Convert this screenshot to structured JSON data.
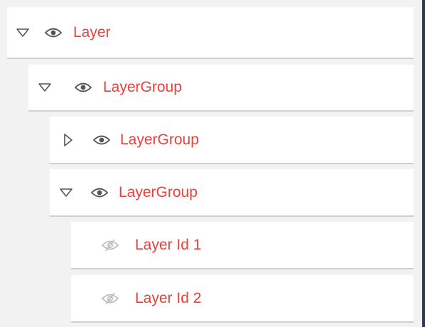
{
  "colors": {
    "label": "#e8403a",
    "icon": "#555555",
    "icon_muted": "#bbbbbb",
    "row_bg": "#ffffff",
    "page_bg": "#f2f2f2"
  },
  "tree": {
    "root": {
      "label": "Layer",
      "state": "expanded",
      "visible": true
    },
    "group1": {
      "label": "LayerGroup",
      "state": "expanded",
      "visible": true
    },
    "group2": {
      "label": "LayerGroup",
      "state": "collapsed",
      "visible": true
    },
    "group3": {
      "label": "LayerGroup",
      "state": "expanded",
      "visible": true
    },
    "layer1": {
      "label": "Layer Id 1",
      "visible": false
    },
    "layer2": {
      "label": "Layer Id 2",
      "visible": false
    }
  },
  "icons": {
    "expanded": "triangle-down-icon",
    "collapsed": "triangle-right-icon",
    "visible": "eye-icon",
    "hidden": "eye-slash-icon"
  }
}
